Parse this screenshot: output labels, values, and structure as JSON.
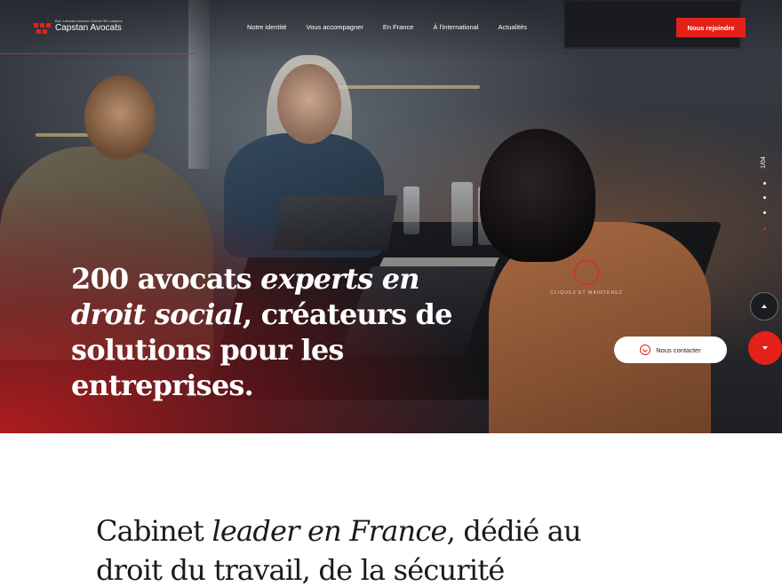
{
  "header": {
    "logo_tagline": "Bon Lebeats Avenue Global HR Lawyers",
    "logo_name": "Capstan Avocats",
    "nav": [
      {
        "label": "Notre identité"
      },
      {
        "label": "Vous accompagner"
      },
      {
        "label": "En France"
      },
      {
        "label": "À l'international"
      },
      {
        "label": "Actualités"
      }
    ],
    "join_button": "Nous rejoindre"
  },
  "hero": {
    "slide_counter": "1/04",
    "slides_total": 4,
    "active_slide": 4,
    "title_part1": "200 avocats ",
    "title_italic1": "experts en droit social",
    "title_part2": ", créateurs de solutions pour les entreprises.",
    "hold_label": "Cliquez et maintenez",
    "contact_button": "Nous contacter"
  },
  "intro": {
    "text_part1": "Cabinet ",
    "text_italic": "leader en France",
    "text_part2": ", dédié au droit du travail, de la sécurité"
  },
  "colors": {
    "accent": "#e32119",
    "text_dark": "#1a1a1a",
    "white": "#ffffff"
  }
}
